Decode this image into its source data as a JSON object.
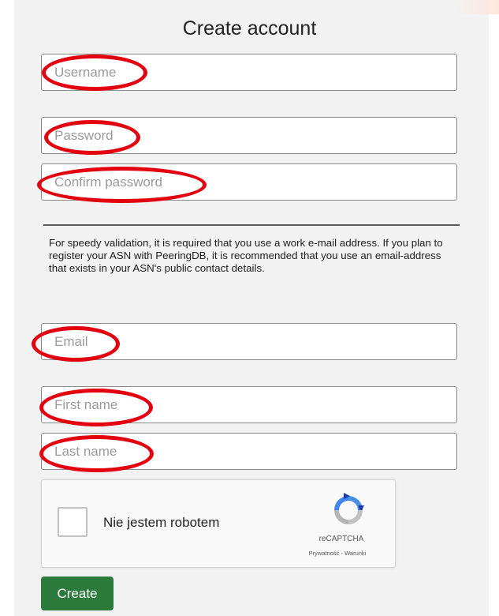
{
  "form": {
    "title": "Create account",
    "fields": {
      "username": {
        "placeholder": "Username",
        "value": ""
      },
      "password": {
        "placeholder": "Password",
        "value": ""
      },
      "confirm_password": {
        "placeholder": "Confirm password",
        "value": ""
      },
      "email": {
        "placeholder": "Email",
        "value": ""
      },
      "first_name": {
        "placeholder": "First name",
        "value": ""
      },
      "last_name": {
        "placeholder": "Last name",
        "value": ""
      }
    },
    "info_text": "For speedy validation, it is required that you use a work e-mail address. If you plan to register your ASN with PeeringDB, it is recommended that you use an email-address that exists in your ASN's public contact details.",
    "submit_label": "Create"
  },
  "captcha": {
    "checkbox_label": "Nie jestem robotem",
    "brand": "reCAPTCHA",
    "links": "Prywatność - Warunki",
    "checked": false
  },
  "annotation": {
    "highlight_color": "#e3000f"
  },
  "colors": {
    "panel_background": "#f2f2f2",
    "button_green": "#2d7a3d"
  }
}
